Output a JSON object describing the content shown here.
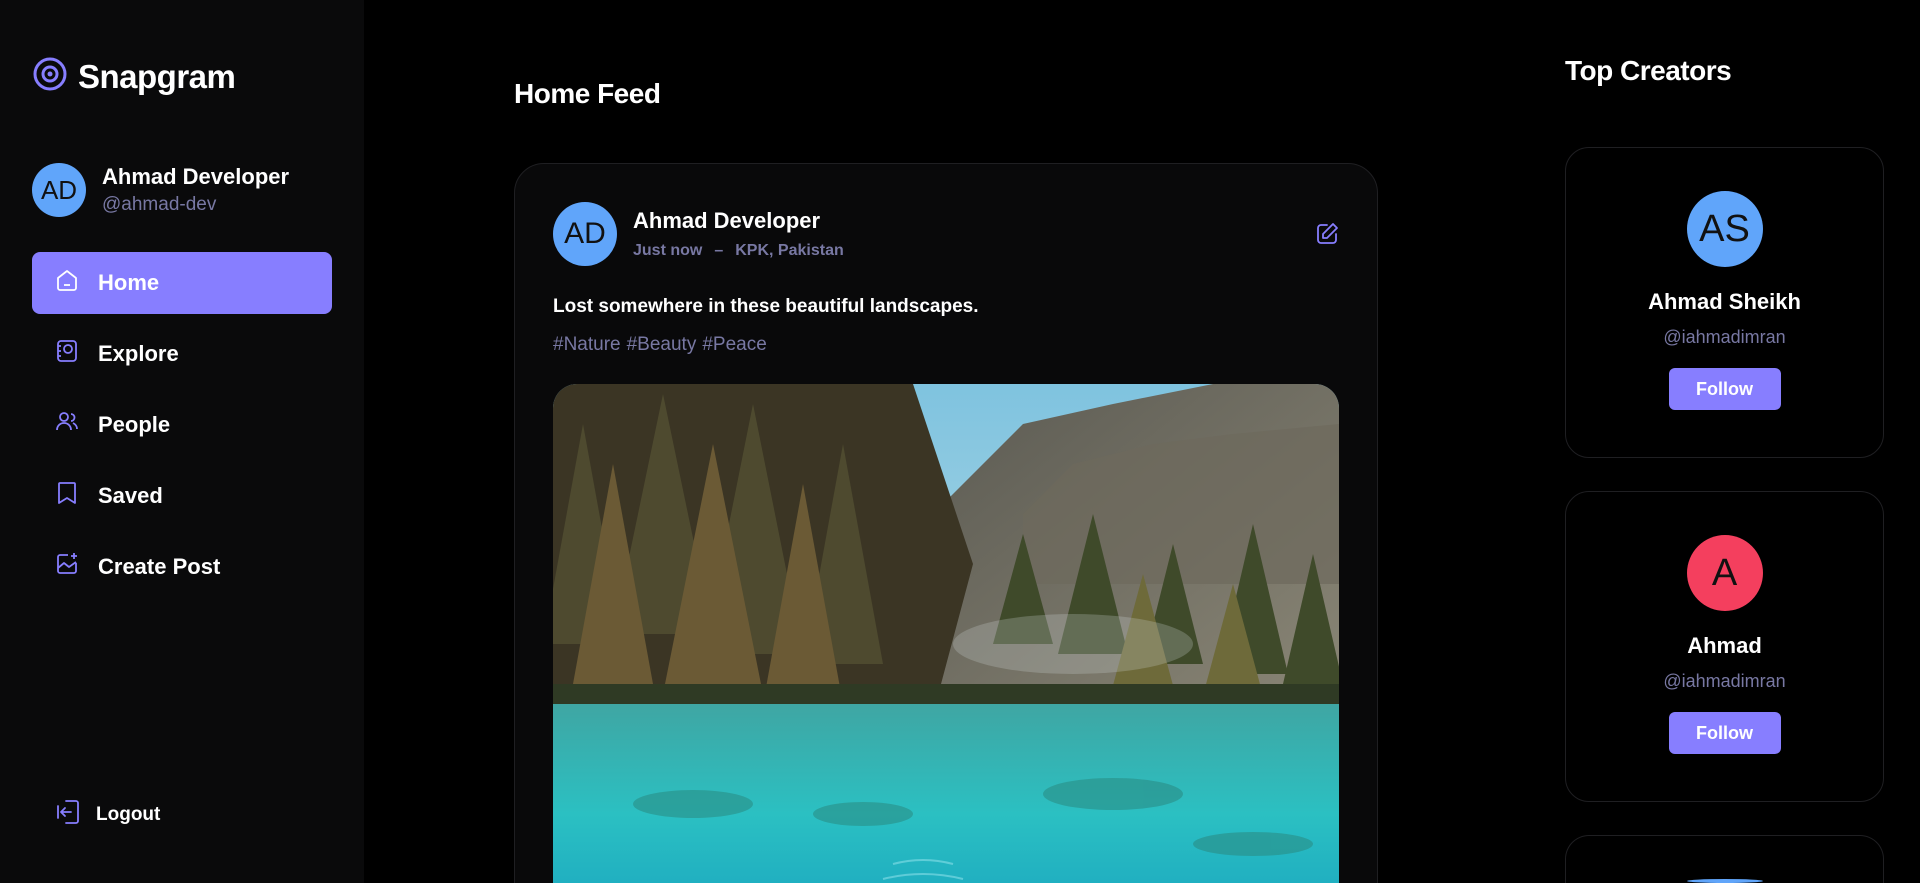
{
  "app": {
    "title": "Snapgram",
    "accent": "#877eff"
  },
  "user": {
    "initials": "AD",
    "name": "Ahmad Developer",
    "handle": "@ahmad-dev",
    "avatar_color": "#60a5fa"
  },
  "nav": {
    "items": [
      {
        "label": "Home",
        "icon": "home-icon",
        "active": true
      },
      {
        "label": "Explore",
        "icon": "explore-icon",
        "active": false
      },
      {
        "label": "People",
        "icon": "people-icon",
        "active": false
      },
      {
        "label": "Saved",
        "icon": "saved-icon",
        "active": false
      },
      {
        "label": "Create Post",
        "icon": "create-post-icon",
        "active": false
      }
    ],
    "logout": "Logout"
  },
  "feed": {
    "title": "Home Feed",
    "post": {
      "author": "Ahmad Developer",
      "initials": "AD",
      "avatar_color": "#60a5fa",
      "time": "Just now",
      "separator": "–",
      "location": "KPK, Pakistan",
      "caption": "Lost somewhere in these beautiful landscapes.",
      "tags": [
        "#Nature",
        "#Beauty",
        "#Peace"
      ]
    }
  },
  "top_creators": {
    "title": "Top Creators",
    "creators": [
      {
        "initials": "AS",
        "name": "Ahmad Sheikh",
        "handle": "@iahmadimran",
        "button": "Follow",
        "avatar_color": "#60a5fa"
      },
      {
        "initials": "A",
        "name": "Ahmad",
        "handle": "@iahmadimran",
        "button": "Follow",
        "avatar_color": "#f43f5e"
      }
    ]
  }
}
